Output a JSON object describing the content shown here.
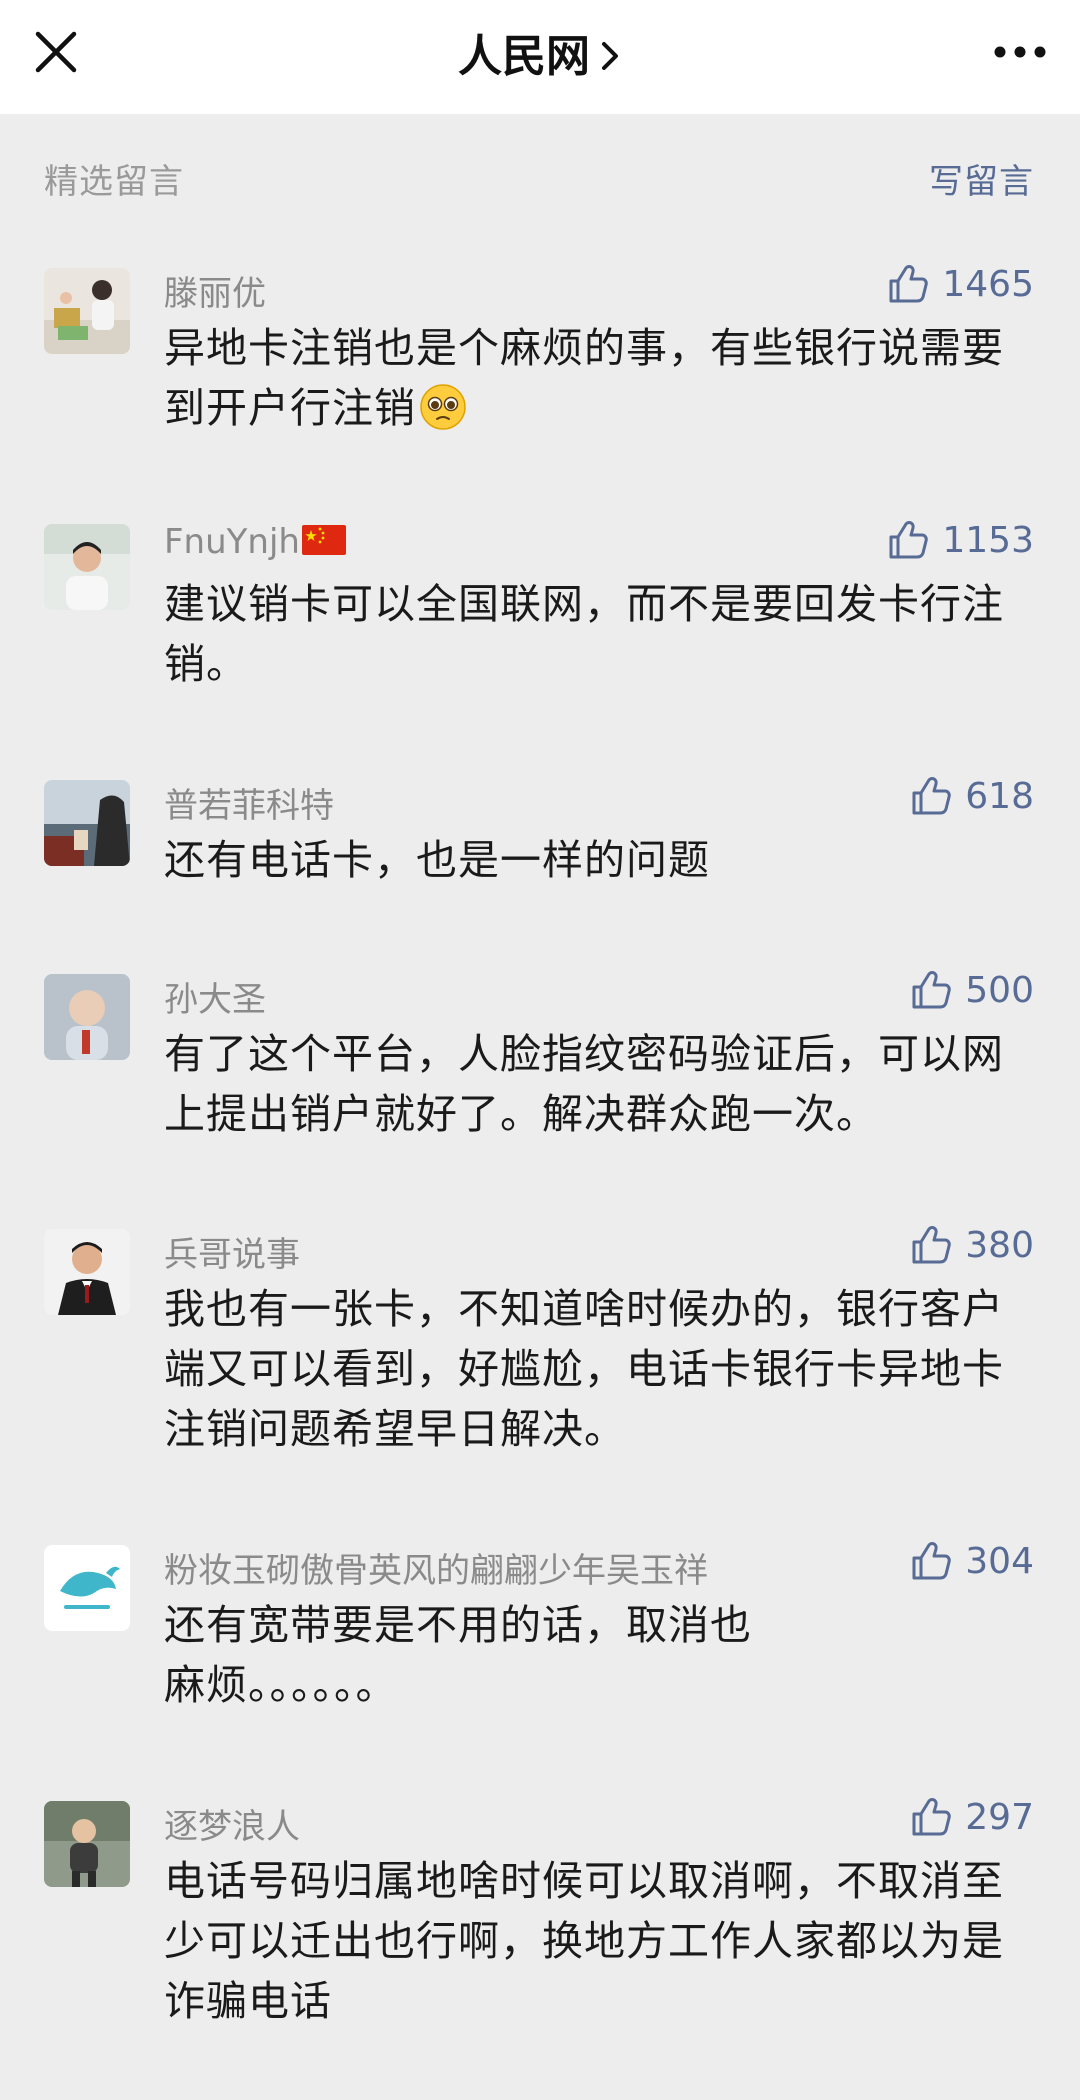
{
  "header": {
    "title": "人民网"
  },
  "section": {
    "title": "精选留言",
    "write_label": "写留言"
  },
  "comments": [
    {
      "nickname": "滕丽优",
      "likes": "1465",
      "text": "异地卡注销也是个麻烦的事，有些银行说需要到开户行注销"
    },
    {
      "nickname": "FnuYnjh",
      "likes": "1153",
      "text": "建议销卡可以全国联网，而不是要回发卡行注销。"
    },
    {
      "nickname": "普若菲科特",
      "likes": "618",
      "text": "还有电话卡，也是一样的问题"
    },
    {
      "nickname": "孙大圣",
      "likes": "500",
      "text": "有了这个平台，人脸指纹密码验证后，可以网上提出销户就好了。解决群众跑一次。"
    },
    {
      "nickname": "兵哥说事",
      "likes": "380",
      "text": "我也有一张卡，不知道啥时候办的，银行客户端又可以看到，好尴尬，电话卡银行卡异地卡注销问题希望早日解决。"
    },
    {
      "nickname": "粉妆玉砌傲骨英风的翩翩少年吴玉祥",
      "likes": "304",
      "text": "还有宽带要是不用的话，取消也麻烦。。。。。。"
    },
    {
      "nickname": "逐梦浪人",
      "likes": "297",
      "text": "电话号码归属地啥时候可以取消啊，不取消至少可以迁出也行啊，换地方工作人家都以为是诈骗电话"
    }
  ]
}
